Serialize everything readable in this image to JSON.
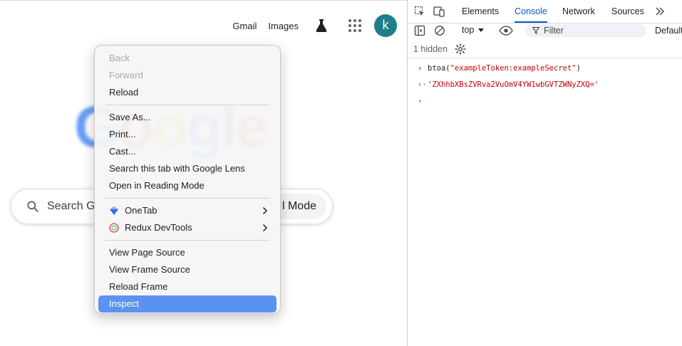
{
  "google": {
    "links": [
      "Gmail",
      "Images"
    ],
    "avatar_letter": "k",
    "logo_letters": [
      {
        "char": "G",
        "color": "#4285f4"
      },
      {
        "char": "o",
        "color": "#ea4335"
      },
      {
        "char": "o",
        "color": "#fbbc05"
      },
      {
        "char": "g",
        "color": "#4285f4"
      },
      {
        "char": "l",
        "color": "#34a853"
      },
      {
        "char": "e",
        "color": "#ea4335"
      }
    ],
    "search_placeholder": "Search G",
    "ai_mode_label": "l Mode"
  },
  "context_menu": {
    "groups": [
      [
        {
          "label": "Back",
          "disabled": true
        },
        {
          "label": "Forward",
          "disabled": true
        },
        {
          "label": "Reload",
          "disabled": false
        }
      ],
      [
        {
          "label": "Save As...",
          "disabled": false
        },
        {
          "label": "Print...",
          "disabled": false
        },
        {
          "label": "Cast...",
          "disabled": false
        },
        {
          "label": "Search this tab with Google Lens",
          "disabled": false
        },
        {
          "label": "Open in Reading Mode",
          "disabled": false
        }
      ],
      [
        {
          "label": "OneTab",
          "icon": "onetab-icon",
          "submenu": true
        },
        {
          "label": "Redux DevTools",
          "icon": "redux-devtools-icon",
          "submenu": true
        }
      ],
      [
        {
          "label": "View Page Source",
          "disabled": false
        },
        {
          "label": "View Frame Source",
          "disabled": false
        },
        {
          "label": "Reload Frame",
          "disabled": false
        },
        {
          "label": "Inspect",
          "disabled": false,
          "selected": true
        }
      ]
    ]
  },
  "devtools": {
    "tabs": [
      {
        "label": "Elements",
        "active": false
      },
      {
        "label": "Console",
        "active": true
      },
      {
        "label": "Network",
        "active": false
      },
      {
        "label": "Sources",
        "active": false
      }
    ],
    "context": "top",
    "filter_placeholder": "Filter",
    "levels_label": "Default",
    "hidden_label": "1 hidden",
    "console": {
      "input_fn": "btoa(",
      "input_arg": "\"exampleToken:exampleSecret\"",
      "input_close": ")",
      "output": "'ZXhhbXBsZVRva2VuOmV4YW1wbGVTZWNyZXQ='"
    },
    "colors": {
      "accent": "#0b57d0",
      "string": "#c80000"
    }
  }
}
